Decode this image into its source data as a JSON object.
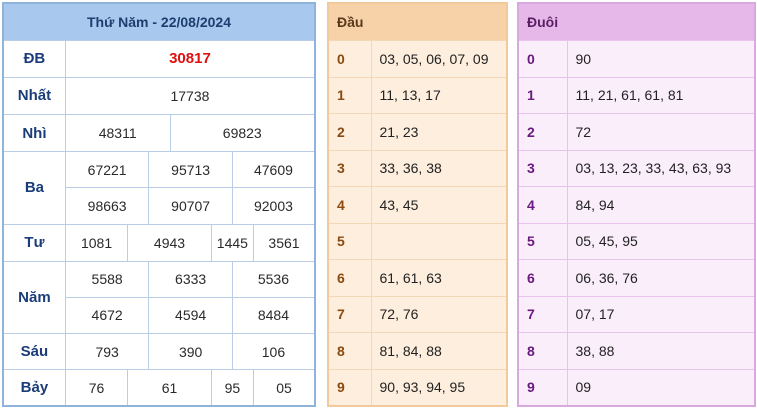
{
  "results": {
    "date_title": "Thứ Năm - 22/08/2024",
    "rows": [
      {
        "label": "ĐB",
        "values": [
          "30817"
        ]
      },
      {
        "label": "Nhất",
        "values": [
          "17738"
        ]
      },
      {
        "label": "Nhì",
        "values": [
          "48311",
          "69823"
        ]
      },
      {
        "label": "Ba",
        "values": [
          "67221",
          "95713",
          "47609",
          "98663",
          "90707",
          "92003"
        ]
      },
      {
        "label": "Tư",
        "values": [
          "1081",
          "4943",
          "1445",
          "3561"
        ]
      },
      {
        "label": "Năm",
        "values": [
          "5588",
          "6333",
          "5536",
          "4672",
          "4594",
          "8484"
        ]
      },
      {
        "label": "Sáu",
        "values": [
          "793",
          "390",
          "106"
        ]
      },
      {
        "label": "Bảy",
        "values": [
          "76",
          "61",
          "95",
          "05"
        ]
      }
    ]
  },
  "head_table": {
    "title": "Đầu",
    "rows": [
      {
        "digit": "0",
        "numbers": "03, 05, 06, 07, 09"
      },
      {
        "digit": "1",
        "numbers": "11, 13, 17"
      },
      {
        "digit": "2",
        "numbers": "21, 23"
      },
      {
        "digit": "3",
        "numbers": "33, 36, 38"
      },
      {
        "digit": "4",
        "numbers": "43, 45"
      },
      {
        "digit": "5",
        "numbers": ""
      },
      {
        "digit": "6",
        "numbers": "61, 61, 63"
      },
      {
        "digit": "7",
        "numbers": "72, 76"
      },
      {
        "digit": "8",
        "numbers": "81, 84, 88"
      },
      {
        "digit": "9",
        "numbers": "90, 93, 94, 95"
      }
    ]
  },
  "tail_table": {
    "title": "Đuôi",
    "rows": [
      {
        "digit": "0",
        "numbers": "90"
      },
      {
        "digit": "1",
        "numbers": "11, 21, 61, 61, 81"
      },
      {
        "digit": "2",
        "numbers": "72"
      },
      {
        "digit": "3",
        "numbers": "03, 13, 23, 33, 43, 63, 93"
      },
      {
        "digit": "4",
        "numbers": "84, 94"
      },
      {
        "digit": "5",
        "numbers": "05, 45, 95"
      },
      {
        "digit": "6",
        "numbers": "06, 36, 76"
      },
      {
        "digit": "7",
        "numbers": "07, 17"
      },
      {
        "digit": "8",
        "numbers": "38, 88"
      },
      {
        "digit": "9",
        "numbers": "09"
      }
    ]
  },
  "colors": {
    "special_prize": "#e01010",
    "results_header": "#a9c8ee",
    "head_bg": "#fdeedd",
    "tail_bg": "#fbeefb"
  }
}
